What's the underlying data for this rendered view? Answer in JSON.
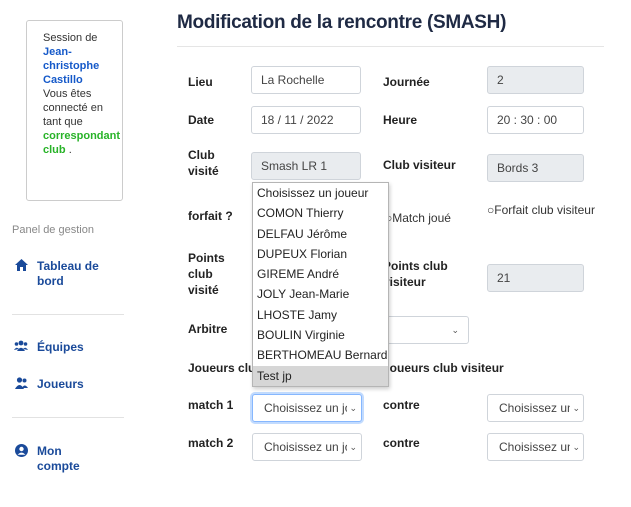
{
  "sidebar": {
    "session_prefix": "Session de",
    "user_name": "Jean-christophe Castillo",
    "role_prefix": "Vous êtes connecté en tant que",
    "role": "correspondant club",
    "role_suffix": ".",
    "panel_title": "Panel de gestion",
    "nav": [
      {
        "label": "Tableau de bord",
        "icon": "home-icon"
      },
      {
        "label": "Équipes",
        "icon": "users-icon"
      },
      {
        "label": "Joueurs",
        "icon": "players-icon"
      },
      {
        "label": "Mon compte",
        "icon": "user-circle-icon"
      }
    ]
  },
  "main": {
    "title": "Modification de la rencontre (SMASH)",
    "lieu": {
      "label": "Lieu",
      "value": "La Rochelle"
    },
    "journee": {
      "label": "Journée",
      "value": "2"
    },
    "date": {
      "label": "Date",
      "value": "18 / 11 / 2022"
    },
    "heure": {
      "label": "Heure",
      "value": "20 : 30 : 00"
    },
    "club_visite": {
      "label": "Club visité",
      "value": "Smash LR 1"
    },
    "club_visiteur": {
      "label": "Club visiteur",
      "value": "Bords 3"
    },
    "forfait": {
      "label": "forfait ?",
      "opt_match_joue": "Match joué",
      "opt_forfait_visiteur": "Forfait club visiteur"
    },
    "points_visite": {
      "label": "Points club visité"
    },
    "points_visiteur": {
      "label": "Points club visiteur",
      "value": "21"
    },
    "arbitre": {
      "label": "Arbitre"
    },
    "joueurs_visite": {
      "label": "Joueurs club"
    },
    "joueurs_visiteur": {
      "label": "Joueurs club visiteur"
    },
    "match1": {
      "label": "match 1",
      "value": "Choisissez un joue",
      "contre": "contre",
      "value2": "Choisissez un jo"
    },
    "match2": {
      "label": "match 2",
      "value": "Choisissez un joue",
      "contre": "contre",
      "value2": "Choisissez un jo"
    }
  },
  "dropdown": {
    "options": [
      "Choisissez un joueur",
      "COMON Thierry",
      "DELFAU Jérôme",
      "DUPEUX Florian",
      "GIREME André",
      "JOLY Jean-Marie",
      "LHOSTE Jamy",
      "BOULIN Virginie",
      "BERTHOMEAU Bernard",
      "Test jp"
    ],
    "highlighted_index": 9
  }
}
